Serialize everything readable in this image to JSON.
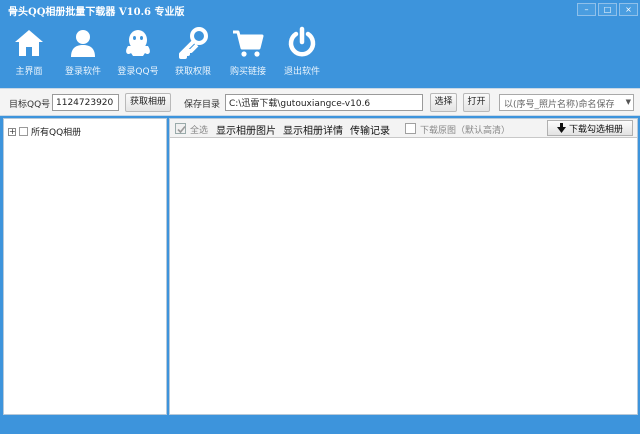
{
  "window": {
    "title": "骨头QQ相册批量下载器 V10.6 专业版",
    "minimize": "–",
    "maximize": "□",
    "close": "×"
  },
  "toolbar": [
    {
      "label": "主界面",
      "icon": "home-icon"
    },
    {
      "label": "登录软件",
      "icon": "user-icon"
    },
    {
      "label": "登录QQ号",
      "icon": "qq-penguin-icon"
    },
    {
      "label": "获取权限",
      "icon": "key-icon"
    },
    {
      "label": "购买链接",
      "icon": "cart-icon"
    },
    {
      "label": "退出软件",
      "icon": "power-icon"
    }
  ],
  "topbar": {
    "target_qq_label": "目标QQ号",
    "target_qq_value": "1124723920",
    "get_album_button": "获取相册",
    "save_dir_label": "保存目录",
    "save_dir_value": "C:\\迅雷下载\\gutouxiangce-v10.6",
    "choose_button": "选择",
    "open_button": "打开",
    "naming_select": "以(序号_照片名称)命名保存"
  },
  "left_panel": {
    "tree_expander": "+",
    "tree_root": "所有QQ相册"
  },
  "right_panel": {
    "select_all": "全选",
    "show_images": "显示相册图片",
    "show_details": "显示相册详情",
    "transfer_log": "传输记录",
    "download_original": "下载原图（默认高清）",
    "download_selected": "下载勾选相册"
  }
}
